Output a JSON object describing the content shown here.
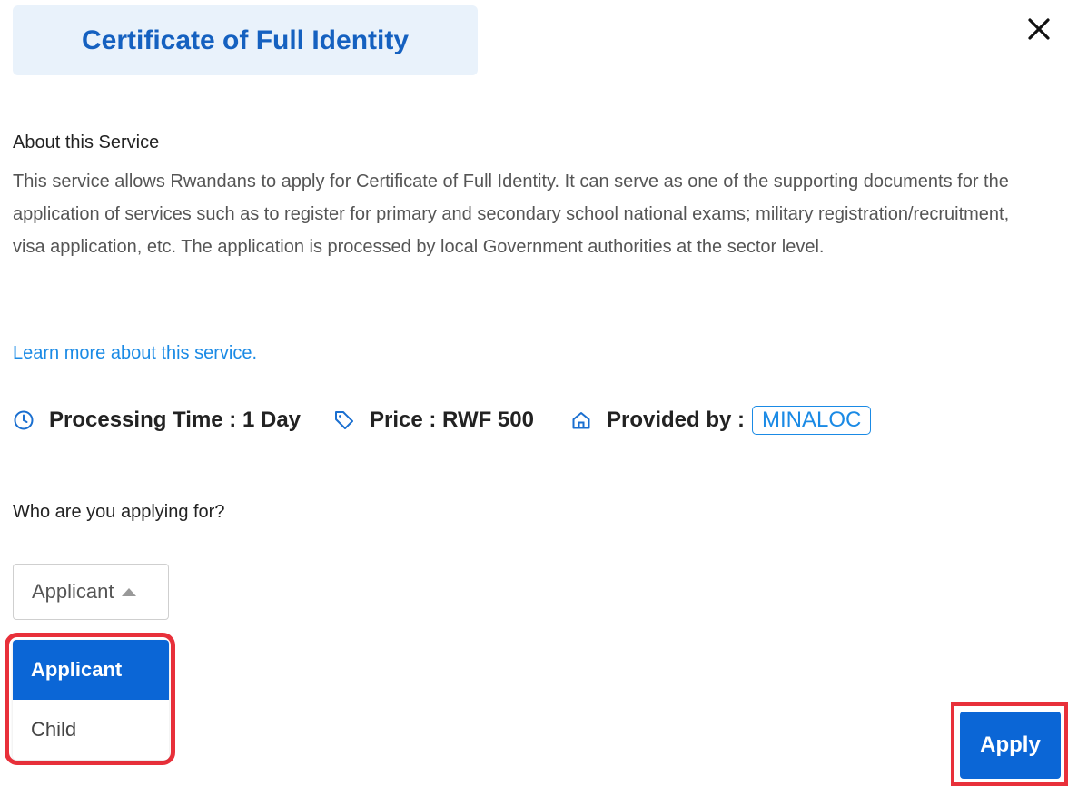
{
  "header": {
    "title": "Certificate of Full Identity"
  },
  "about": {
    "heading": "About this Service",
    "text": "This service allows Rwandans to apply for Certificate of Full Identity. It can serve as one of the supporting documents for the application of services such as to register for primary and secondary school national exams; military registration/recruitment, visa application, etc. The application is processed by local Government authorities at the sector level.",
    "learn_more": "Learn more about this service."
  },
  "info": {
    "processing_time": "Processing Time : 1 Day",
    "price": "Price : RWF 500",
    "provided_by_label": "Provided by :",
    "provider": "MINALOC"
  },
  "form": {
    "question": "Who are you applying for?",
    "selected": "Applicant",
    "options": [
      "Applicant",
      "Child"
    ]
  },
  "actions": {
    "apply": "Apply"
  },
  "colors": {
    "accent": "#0b66d6",
    "link": "#1a8ae5",
    "title": "#1561c0",
    "highlight": "#e8303a"
  },
  "icons": {
    "close": "close-icon",
    "time": "clock-icon",
    "price": "tag-icon",
    "provider": "home-icon"
  }
}
